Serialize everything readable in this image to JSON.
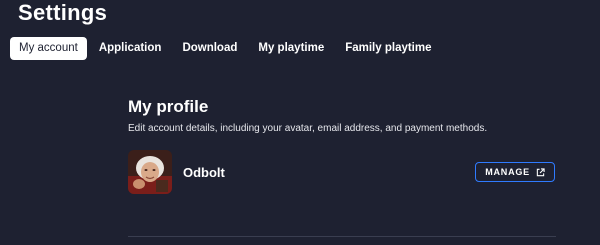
{
  "page": {
    "title": "Settings"
  },
  "tabs": [
    {
      "label": "My account",
      "active": true
    },
    {
      "label": "Application",
      "active": false
    },
    {
      "label": "Download",
      "active": false
    },
    {
      "label": "My playtime",
      "active": false
    },
    {
      "label": "Family playtime",
      "active": false
    }
  ],
  "profile": {
    "title": "My profile",
    "subtitle": "Edit account details, including your avatar, email address, and payment methods.",
    "username": "Odbolt",
    "manage_label": "MANAGE",
    "manage_icon": "external-link-icon"
  },
  "colors": {
    "background": "#1e2131",
    "accent": "#2f7bff",
    "active_tab_bg": "#ffffff"
  }
}
